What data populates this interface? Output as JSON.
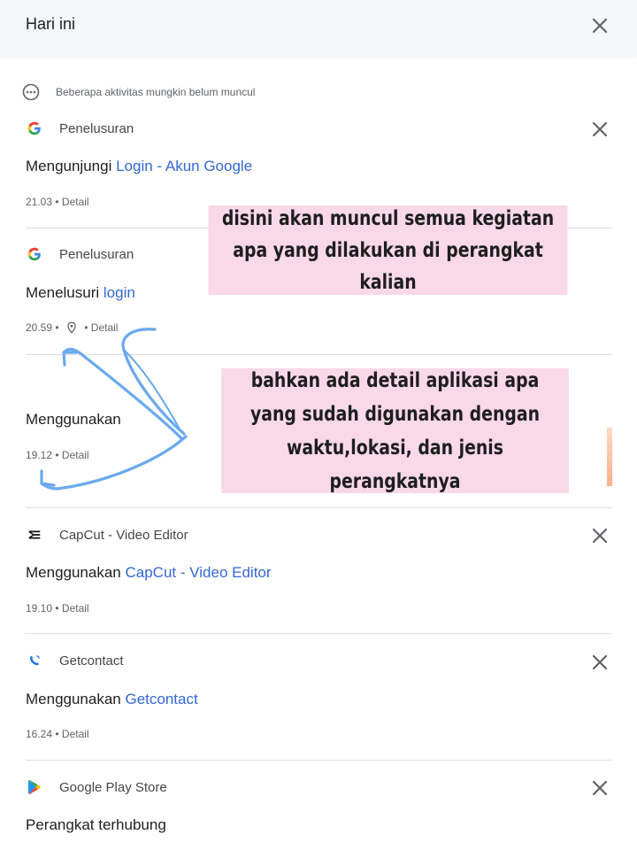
{
  "header": {
    "title": "Hari ini"
  },
  "notice": {
    "text": "Beberapa aktivitas mungkin belum muncul"
  },
  "items": [
    {
      "app": "Penelusuran",
      "action": "Mengunjungi",
      "link": "Login - Akun Google",
      "time": "21.03",
      "detail": "Detail"
    },
    {
      "app": "Penelusuran",
      "action": "Menelusuri",
      "link": "login",
      "time": "20.59",
      "detail": "Detail"
    },
    {
      "app": "",
      "action": "Menggunakan",
      "link": "",
      "time": "19.12",
      "detail": "Detail"
    },
    {
      "app": "CapCut - Video Editor",
      "action": "Menggunakan",
      "link": "CapCut - Video Editor",
      "time": "19.10",
      "detail": "Detail"
    },
    {
      "app": "Getcontact",
      "action": "Menggunakan",
      "link": "Getcontact",
      "time": "16.24",
      "detail": "Detail"
    },
    {
      "app": "Google Play Store",
      "action": "Perangkat terhubung",
      "link": "",
      "time": "",
      "detail": ""
    }
  ],
  "annotations": {
    "first": "disini akan muncul semua kegiatan apa yang dilakukan di perangkat kalian",
    "second": "bahkan ada detail aplikasi apa yang sudah digunakan dengan waktu,lokasi, dan jenis perangkatnya"
  },
  "icons": {
    "close": "close-icon",
    "more": "more-horizontal-icon",
    "google": "google-g-icon",
    "capcut": "capcut-icon",
    "getcontact": "getcontact-icon",
    "play": "play-store-icon",
    "pin": "location-pin-icon"
  },
  "colors": {
    "link": "#3367d6",
    "annotation_bg": "#f9d8e7",
    "arrow": "#6aa9ee"
  }
}
